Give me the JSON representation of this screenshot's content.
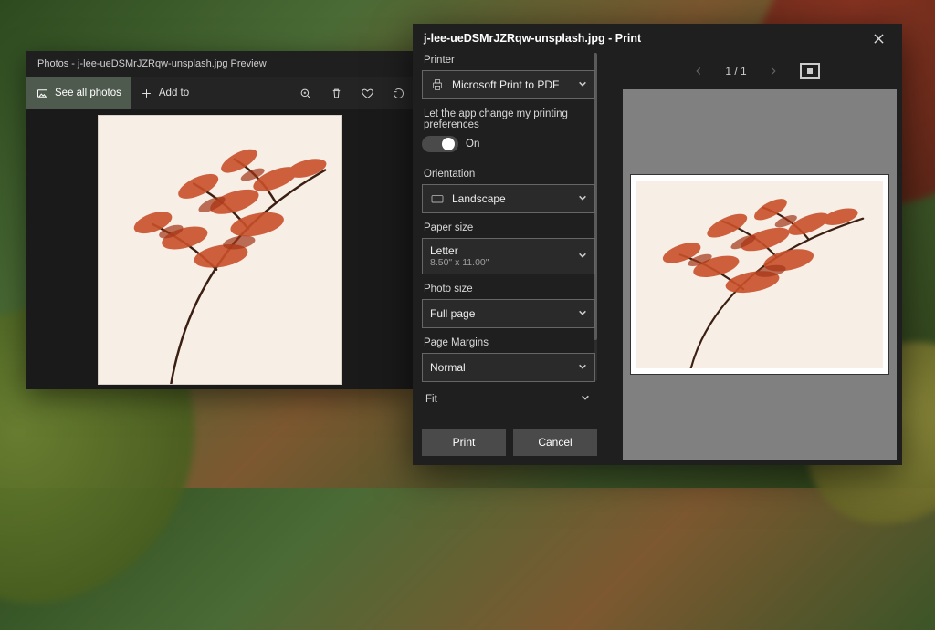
{
  "photosApp": {
    "title": "Photos - j-lee-ueDSMrJZRqw-unsplash.jpg Preview",
    "seeAll": "See all photos",
    "addTo": "Add to"
  },
  "printDialog": {
    "title": "j-lee-ueDSMrJZRqw-unsplash.jpg - Print",
    "printerLabel": "Printer",
    "printer": "Microsoft Print to PDF",
    "appPrefLabel": "Let the app change my printing preferences",
    "appPrefOn": "On",
    "orientationLabel": "Orientation",
    "orientation": "Landscape",
    "paperSizeLabel": "Paper size",
    "paperSize": "Letter",
    "paperSizeDims": "8.50\" x 11.00\"",
    "photoSizeLabel": "Photo size",
    "photoSize": "Full page",
    "marginsLabel": "Page Margins",
    "margins": "Normal",
    "fitLabel": "Fit",
    "pagination": "1 / 1",
    "printBtn": "Print",
    "cancelBtn": "Cancel"
  }
}
